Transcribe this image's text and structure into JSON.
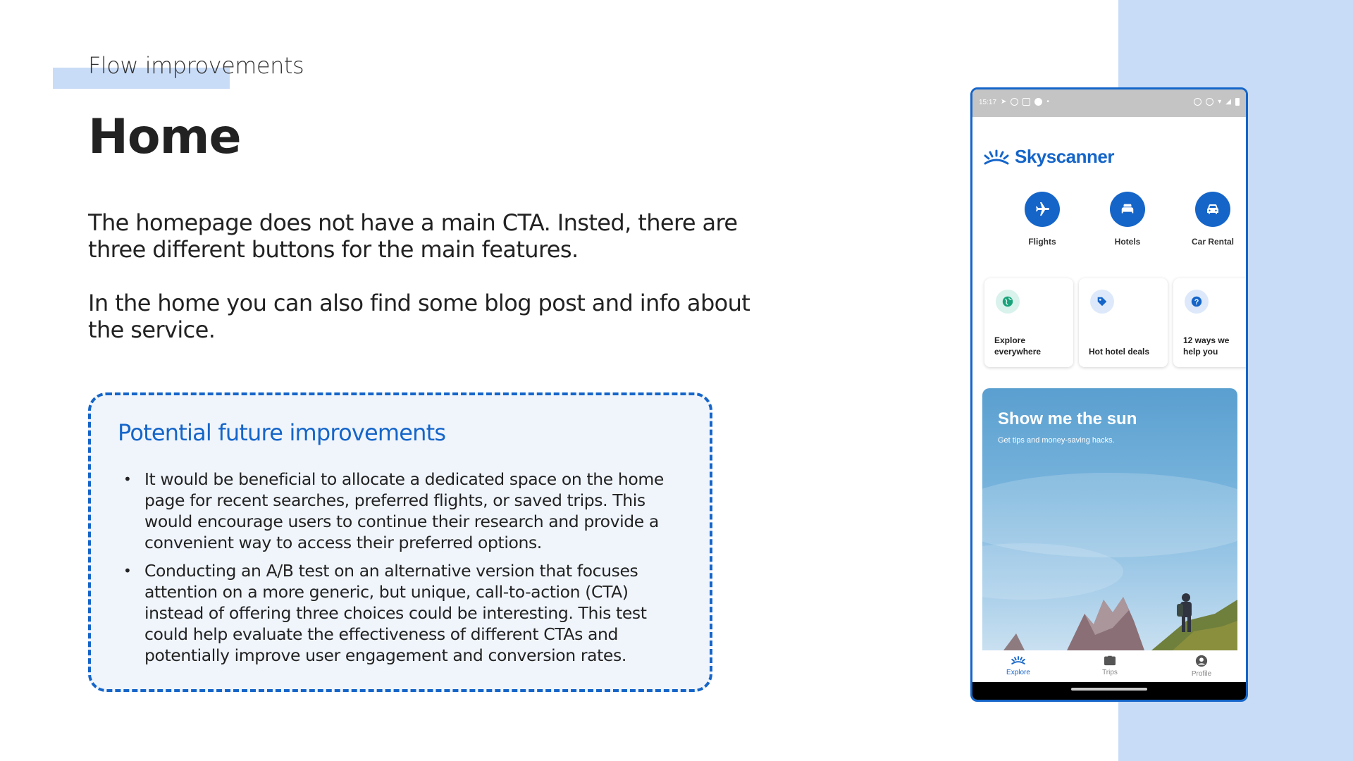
{
  "slide": {
    "kicker": "Flow improvements",
    "title": "Home",
    "paragraph1": "The homepage does not have a main CTA. Insted, there are three different buttons for the main features.",
    "paragraph2": "In the home you can also find some blog post and info about the service.",
    "accent_color": "#1565c9",
    "panel_color": "#c9dcf7"
  },
  "callout": {
    "title": "Potential future improvements",
    "bullets": [
      "It would be beneficial to allocate a dedicated space on the home page for recent searches, preferred flights, or saved trips. This would encourage users to continue their research and provide a convenient way to access their preferred options.",
      "Conducting an A/B test on an alternative version that focuses attention on a more generic, but unique, call-to-action (CTA) instead of offering three choices could be interesting. This test could help evaluate the effectiveness of different CTAs and potentially improve user engagement and conversion rates."
    ]
  },
  "phone": {
    "status_time": "15:17",
    "logo": "Skyscanner",
    "quick_actions": [
      {
        "label": "Flights",
        "icon": "plane-icon"
      },
      {
        "label": "Hotels",
        "icon": "bed-icon"
      },
      {
        "label": "Car Rental",
        "icon": "car-icon"
      }
    ],
    "cards": [
      {
        "label": "Explore everywhere",
        "icon": "globe-icon",
        "icon_bg": "#d9f2ec"
      },
      {
        "label": "Hot hotel deals",
        "icon": "tag-icon",
        "icon_bg": "#dde9fa"
      },
      {
        "label": "12 ways we help you",
        "icon": "question-icon",
        "icon_bg": "#dde9fa"
      }
    ],
    "hero": {
      "title": "Show me the sun",
      "subtitle": "Get tips and money-saving hacks."
    },
    "nav": [
      {
        "label": "Explore",
        "icon": "explore-icon",
        "active": true
      },
      {
        "label": "Trips",
        "icon": "briefcase-icon",
        "active": false
      },
      {
        "label": "Profile",
        "icon": "profile-icon",
        "active": false
      }
    ]
  }
}
